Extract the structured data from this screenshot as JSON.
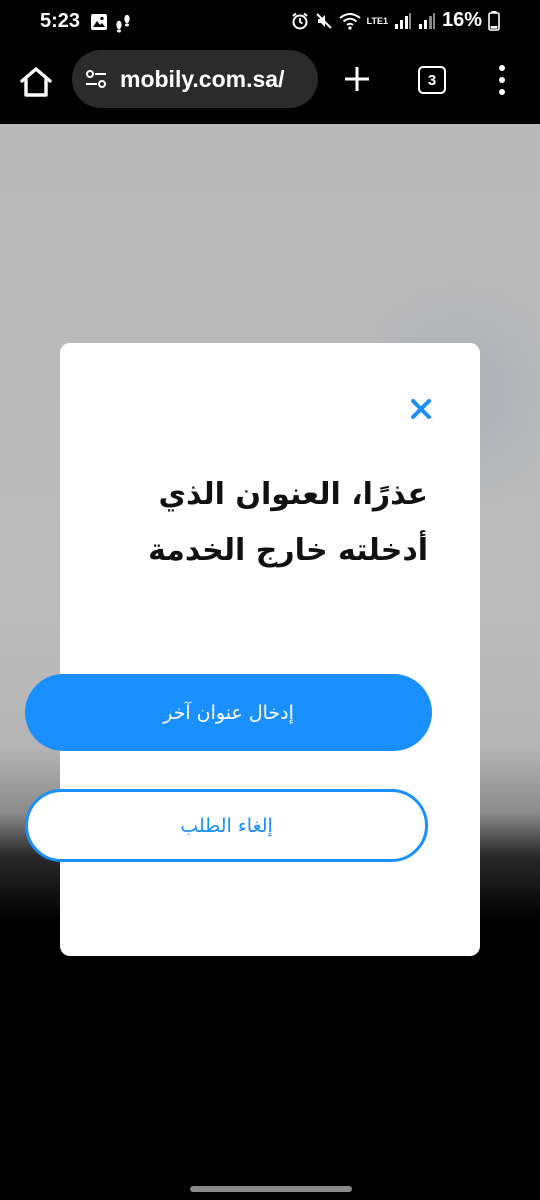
{
  "status_bar": {
    "time": "5:23",
    "battery": "16%",
    "network_label": "LTE1"
  },
  "browser": {
    "url": "mobily.com.sa/",
    "tab_count": "3"
  },
  "modal": {
    "title_line1": "عذرًا، العنوان الذي",
    "title_line2": "أدخلته خارج الخدمة",
    "primary_button": "إدخال عنوان آخر",
    "secondary_button": "إلغاء الطلب"
  },
  "colors": {
    "accent": "#1a8fff",
    "modal_bg": "#ffffff",
    "toolbar_bg": "#000000",
    "url_pill_bg": "#2b2b2b"
  }
}
